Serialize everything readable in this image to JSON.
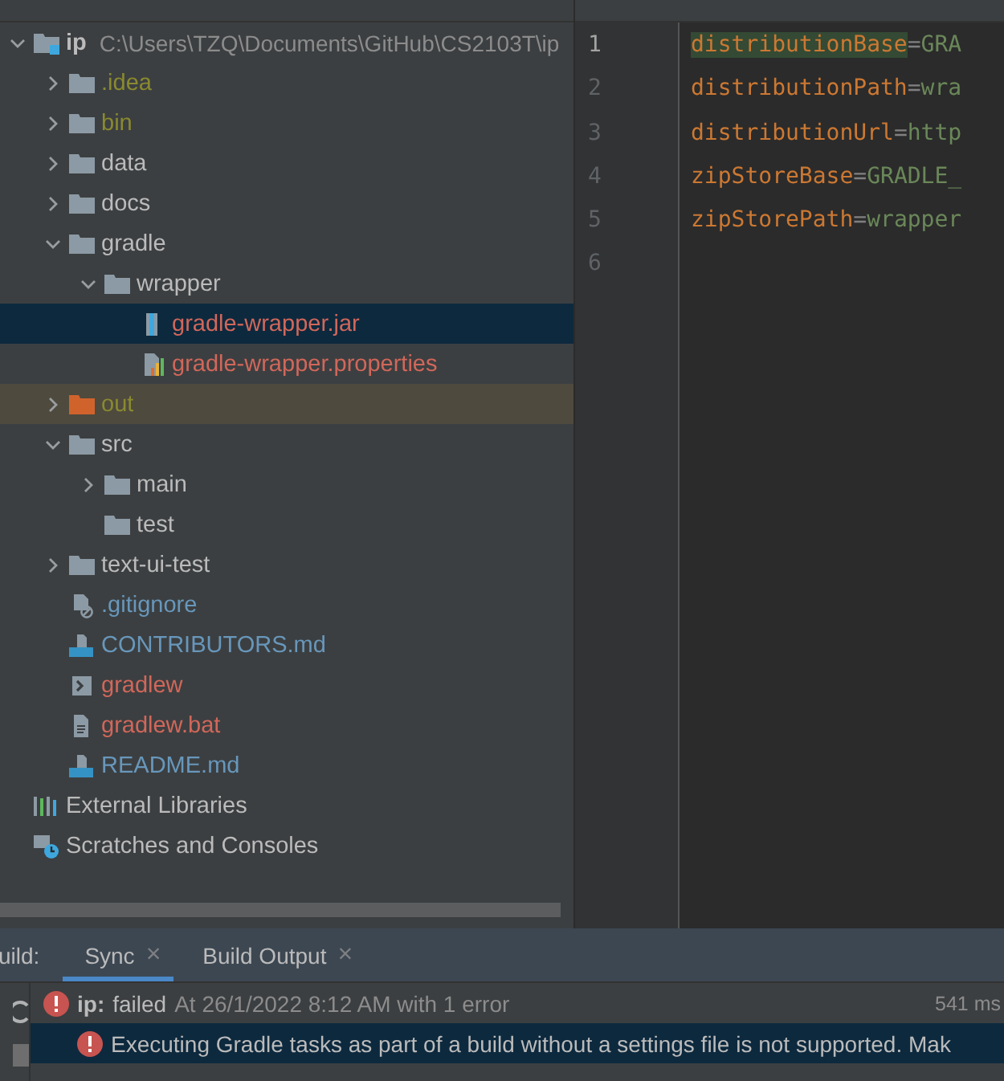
{
  "project_tree": [
    {
      "label": "ip",
      "kind": "module",
      "path": "C:\\Users\\TZQ\\Documents\\GitHub\\CS2103T\\ip",
      "color": "#bbbbbb",
      "expanded": true,
      "selected": false,
      "children": [
        {
          "label": ".idea",
          "kind": "folder",
          "color": "#8a8a30",
          "expanded": false,
          "selected": false
        },
        {
          "label": "bin",
          "kind": "folder",
          "color": "#8a8a30",
          "expanded": false,
          "selected": false
        },
        {
          "label": "data",
          "kind": "folder",
          "color": "#bbbbbb",
          "expanded": false,
          "selected": false
        },
        {
          "label": "docs",
          "kind": "folder",
          "color": "#bbbbbb",
          "expanded": false,
          "selected": false
        },
        {
          "label": "gradle",
          "kind": "folder",
          "color": "#bbbbbb",
          "expanded": true,
          "selected": false,
          "children": [
            {
              "label": "wrapper",
              "kind": "folder",
              "color": "#bbbbbb",
              "expanded": true,
              "selected": false,
              "children": [
                {
                  "label": "gradle-wrapper.jar",
                  "kind": "jar",
                  "color": "#d1675a",
                  "selected": true
                },
                {
                  "label": "gradle-wrapper.properties",
                  "kind": "properties",
                  "color": "#d1675a",
                  "selected": false
                }
              ]
            }
          ]
        },
        {
          "label": "out",
          "kind": "excluded_folder",
          "color": "#8a8a30",
          "expanded": false,
          "selected": false
        },
        {
          "label": "src",
          "kind": "folder",
          "color": "#bbbbbb",
          "expanded": true,
          "selected": false,
          "children": [
            {
              "label": "main",
              "kind": "folder",
              "color": "#bbbbbb",
              "expanded": false,
              "selected": false
            },
            {
              "label": "test",
              "kind": "folder",
              "color": "#bbbbbb",
              "selected": false
            }
          ]
        },
        {
          "label": "text-ui-test",
          "kind": "folder",
          "color": "#bbbbbb",
          "expanded": false,
          "selected": false
        },
        {
          "label": ".gitignore",
          "kind": "gitignore",
          "color": "#6897bb",
          "selected": false
        },
        {
          "label": "CONTRIBUTORS.md",
          "kind": "markdown",
          "color": "#6897bb",
          "selected": false
        },
        {
          "label": "gradlew",
          "kind": "shell",
          "color": "#d1675a",
          "selected": false
        },
        {
          "label": "gradlew.bat",
          "kind": "text",
          "color": "#d1675a",
          "selected": false
        },
        {
          "label": "README.md",
          "kind": "markdown",
          "color": "#6897bb",
          "selected": false
        }
      ]
    },
    {
      "label": "External Libraries",
      "kind": "libraries",
      "color": "#bbbbbb",
      "selected": false
    },
    {
      "label": "Scratches and Consoles",
      "kind": "scratches",
      "color": "#bbbbbb",
      "selected": false
    }
  ],
  "editor": {
    "lines": [
      {
        "number": "1",
        "key": "distributionBase",
        "sep": "=",
        "value": "GRA",
        "key_highlighted": true
      },
      {
        "number": "2",
        "key": "distributionPath",
        "sep": "=",
        "value": "wra",
        "key_highlighted": false
      },
      {
        "number": "3",
        "key": "distributionUrl",
        "sep": "=",
        "value": "http",
        "key_highlighted": false
      },
      {
        "number": "4",
        "key": "zipStoreBase",
        "sep": "=",
        "value": "GRADLE_",
        "key_highlighted": false
      },
      {
        "number": "5",
        "key": "zipStorePath",
        "sep": "=",
        "value": "wrapper",
        "key_highlighted": false
      },
      {
        "number": "6"
      }
    ]
  },
  "build": {
    "title": "uild:",
    "tabs": [
      {
        "label": "Sync",
        "selected": true,
        "close": "×"
      },
      {
        "label": "Build Output",
        "selected": false,
        "close": "×"
      }
    ],
    "rows": [
      {
        "kind": "summary",
        "name": "ip:",
        "status": "failed",
        "detail": "At 26/1/2022 8:12 AM with 1 error",
        "time": "541 ms",
        "selected": false
      },
      {
        "kind": "error",
        "message": "Executing Gradle tasks as part of a build without a settings file is not supported. Mak",
        "selected": true
      }
    ]
  }
}
